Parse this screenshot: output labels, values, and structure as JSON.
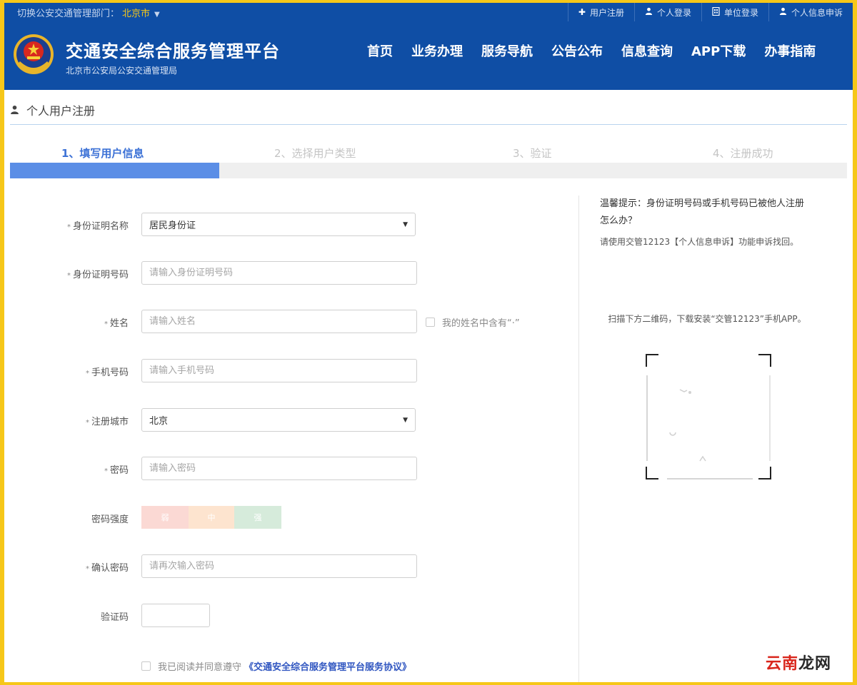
{
  "topbar": {
    "city_switch_label": "切换公安交通管理部门：",
    "city": "北京市",
    "links": [
      {
        "icon": "plus-icon",
        "glyph": "✚",
        "label": "用户注册"
      },
      {
        "icon": "user-icon",
        "glyph": "👤",
        "label": "个人登录"
      },
      {
        "icon": "building-icon",
        "glyph": "▤",
        "label": "单位登录"
      },
      {
        "icon": "user-search-icon",
        "glyph": "👤",
        "label": "个人信息申诉"
      }
    ]
  },
  "header": {
    "title": "交通安全综合服务管理平台",
    "subtitle": "北京市公安局公安交通管理局",
    "nav": [
      "首页",
      "业务办理",
      "服务导航",
      "公告公布",
      "信息查询",
      "APP下载",
      "办事指南"
    ]
  },
  "page": {
    "title": "个人用户注册"
  },
  "steps": {
    "items": [
      "1、填写用户信息",
      "2、选择用户类型",
      "3、验证",
      "4、注册成功"
    ],
    "active_index": 0,
    "progress": 0.25
  },
  "form": {
    "id_type": {
      "label": "身份证明名称",
      "value": "居民身份证"
    },
    "id_number": {
      "label": "身份证明号码",
      "placeholder": "请输入身份证明号码"
    },
    "name": {
      "label": "姓名",
      "placeholder": "请输入姓名",
      "dot_checkbox_label": "我的姓名中含有“·”"
    },
    "phone": {
      "label": "手机号码",
      "placeholder": "请输入手机号码"
    },
    "city": {
      "label": "注册城市",
      "value": "北京"
    },
    "password": {
      "label": "密码",
      "placeholder": "请输入密码"
    },
    "strength": {
      "label": "密码强度",
      "levels": [
        "弱",
        "中",
        "强"
      ]
    },
    "confirm": {
      "label": "确认密码",
      "placeholder": "请再次输入密码"
    },
    "captcha": {
      "label": "验证码"
    },
    "agree": {
      "text": "我已阅读并同意遵守",
      "link": "《交通安全综合服务管理平台服务协议》"
    }
  },
  "side": {
    "tip_title": "温馨提示：身份证明号码或手机号码已被他人注册怎么办？",
    "tip_body": "请使用交管12123【个人信息申诉】功能申诉找回。",
    "qr_text": "扫描下方二维码，下载安装“交管12123”手机APP。"
  },
  "watermark": {
    "red": "云南",
    "black": "龙网"
  }
}
